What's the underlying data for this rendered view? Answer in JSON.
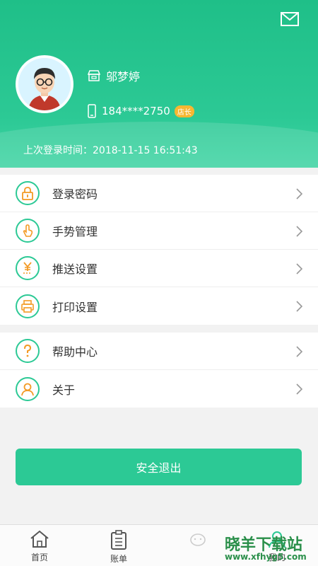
{
  "header": {
    "user_name": "邬梦婷",
    "phone": "184****2750",
    "role_badge": "店长",
    "last_login": "上次登录时间：2018-11-15 16:51:43"
  },
  "menu_group_1": [
    {
      "label": "登录密码",
      "icon": "lock-icon"
    },
    {
      "label": "手势管理",
      "icon": "gesture-hand-icon"
    },
    {
      "label": "推送设置",
      "icon": "yen-push-icon"
    },
    {
      "label": "打印设置",
      "icon": "printer-icon"
    }
  ],
  "menu_group_2": [
    {
      "label": "帮助中心",
      "icon": "question-icon"
    },
    {
      "label": "关于",
      "icon": "person-icon"
    }
  ],
  "logout_label": "安全退出",
  "tabs": [
    {
      "label": "首页",
      "icon": "home-icon"
    },
    {
      "label": "账单",
      "icon": "clipboard-icon"
    },
    {
      "label": "",
      "icon": "sheep-icon"
    },
    {
      "label": "我的",
      "icon": "user-icon"
    }
  ],
  "watermark": {
    "text": "晓羊下载站",
    "url": "www.xfhyg5.com"
  },
  "colors": {
    "accent": "#2cc995",
    "icon_orange": "#f39a24",
    "badge": "#f7b731"
  }
}
